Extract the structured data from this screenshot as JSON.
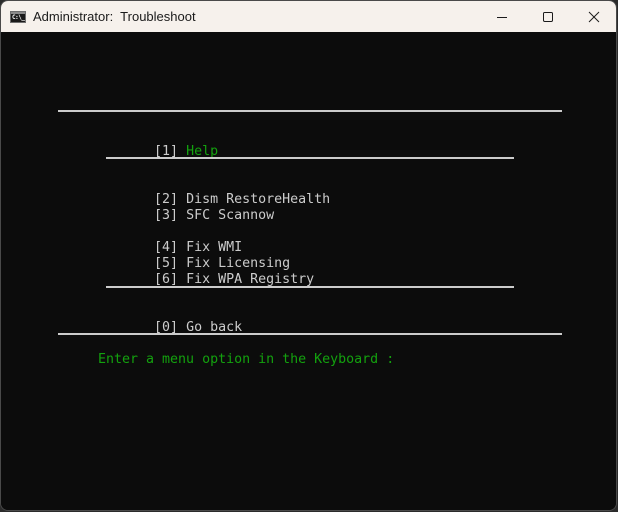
{
  "window": {
    "title": "Administrator:  Troubleshoot",
    "app_icon_text": "C:\\_",
    "controls": {
      "minimize": "minimize-icon",
      "maximize": "maximize-icon",
      "close": "close-icon"
    }
  },
  "terminal": {
    "colors": {
      "background": "#0c0c0c",
      "text": "#cccccc",
      "accent_green": "#13a10e"
    },
    "menu": {
      "help": {
        "key": "[1]",
        "label": "Help"
      },
      "items_group1": [
        {
          "key": "[2]",
          "label": "Dism RestoreHealth"
        },
        {
          "key": "[3]",
          "label": "SFC Scannow"
        }
      ],
      "items_group2": [
        {
          "key": "[4]",
          "label": "Fix WMI"
        },
        {
          "key": "[5]",
          "label": "Fix Licensing"
        },
        {
          "key": "[6]",
          "label": "Fix WPA Registry"
        }
      ],
      "back": {
        "key": "[0]",
        "label": "Go back"
      }
    },
    "prompt": "Enter a menu option in the Keyboard :"
  }
}
